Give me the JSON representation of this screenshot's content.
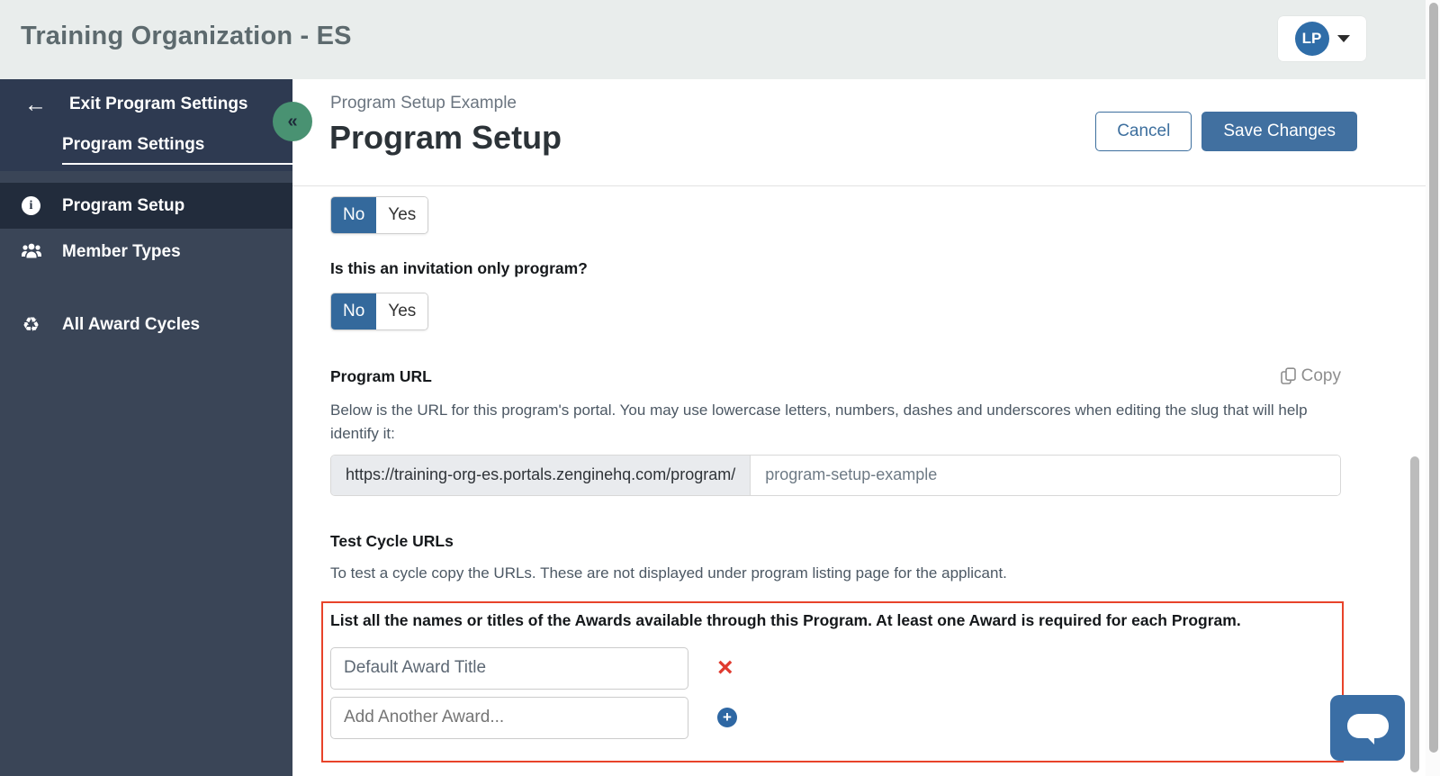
{
  "header": {
    "title": "Training Organization - ES",
    "user_initials": "LP"
  },
  "sidebar": {
    "exit_label": "Exit Program Settings",
    "section_label": "Program Settings",
    "collapse_glyph": "«",
    "nav": [
      {
        "label": "Program Setup",
        "icon": "info-icon",
        "active": true
      },
      {
        "label": "Member Types",
        "icon": "members-icon",
        "active": false
      },
      {
        "label": "All Award Cycles",
        "icon": "cycles-icon",
        "active": false
      }
    ]
  },
  "page": {
    "breadcrumb": "Program Setup Example",
    "title": "Program Setup",
    "cancel_label": "Cancel",
    "save_label": "Save Changes"
  },
  "form": {
    "toggle_top": {
      "no": "No",
      "yes": "Yes",
      "selected": "No"
    },
    "invitation_question": "Is this an invitation only program?",
    "toggle_invitation": {
      "no": "No",
      "yes": "Yes",
      "selected": "No"
    },
    "program_url": {
      "label": "Program URL",
      "copy_label": "Copy",
      "description": "Below is the URL for this program's portal. You may use lowercase letters, numbers, dashes and underscores when editing the slug that will help identify it:",
      "url_prefix": "https://training-org-es.portals.zenginehq.com/program/",
      "slug_value": "program-setup-example"
    },
    "test_cycle": {
      "label": "Test Cycle URLs",
      "description": "To test a cycle copy the URLs. These are not displayed under program listing page for the applicant."
    },
    "awards": {
      "instruction": "List all the names or titles of the Awards available through this Program. At least one Award is required for each Program.",
      "award_1_value": "Default Award Title",
      "add_placeholder": "Add Another Award...",
      "remove_glyph": "×",
      "add_glyph": "+"
    }
  },
  "colors": {
    "accent_blue": "#4170a0",
    "toggle_blue": "#34699c",
    "sidebar_navy": "#3a4557",
    "annotation_red": "#e8432a",
    "collapse_green": "#499272",
    "avatar_blue": "#2f6da8"
  }
}
